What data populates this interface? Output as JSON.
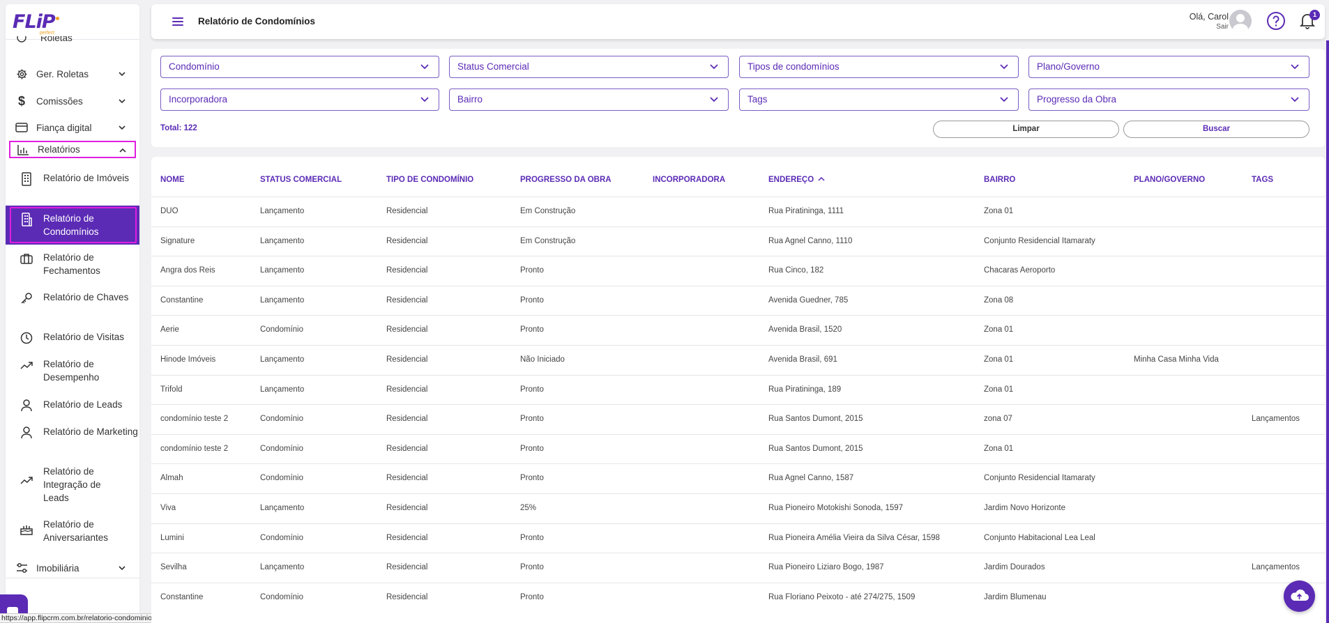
{
  "sidebar": {
    "logo": "FLiP",
    "logo_sub": "perfect",
    "items": [
      {
        "label": "Roletas",
        "icon": "roulette-icon"
      },
      {
        "label": "Ger. Roletas",
        "icon": "gear-icon"
      },
      {
        "label": "Comissões",
        "icon": "dollar-icon"
      },
      {
        "label": "Fiança digital",
        "icon": "credit-card-icon"
      },
      {
        "label": "Relatórios",
        "icon": "bar-chart-icon"
      },
      {
        "label": "Imobiliária",
        "icon": "settings-sliders-icon"
      }
    ],
    "reports": [
      {
        "label": "Relatório de Imóveis",
        "icon": "building-icon"
      },
      {
        "label": "Relatório de Condomínios",
        "icon": "condo-building-icon"
      },
      {
        "label": "Relatório de Fechamentos",
        "icon": "briefcase-icon"
      },
      {
        "label": "Relatório de Chaves",
        "icon": "key-icon"
      },
      {
        "label": "Relatório de Visitas",
        "icon": "clock-icon"
      },
      {
        "label": "Relatório de Desempenho",
        "icon": "trending-up-icon"
      },
      {
        "label": "Relatório de Leads",
        "icon": "user-icon"
      },
      {
        "label": "Relatório de Marketing",
        "icon": "user-icon"
      },
      {
        "label": "Relatório de Integração de Leads",
        "icon": "trending-up-icon"
      },
      {
        "label": "Relatório de Aniversariantes",
        "icon": "cake-icon"
      }
    ]
  },
  "status_url": "https://app.flipcrm.com.br/relatorio-condominios",
  "header": {
    "title": "Relatório de Condomínios",
    "greeting": "Olá, Carol",
    "logout": "Sair",
    "notification_count": "1"
  },
  "filters": {
    "row1": [
      "Condomínio",
      "Status Comercial",
      "Tipos de condomínios",
      "Plano/Governo"
    ],
    "row2": [
      "Incorporadora",
      "Bairro",
      "Tags",
      "Progresso da Obra"
    ],
    "total": "Total: 122",
    "clear_label": "Limpar",
    "search_label": "Buscar"
  },
  "table": {
    "columns": [
      "NOME",
      "STATUS COMERCIAL",
      "TIPO DE CONDOMÍNIO",
      "PROGRESSO DA OBRA",
      "INCORPORADORA",
      "ENDEREÇO",
      "BAIRRO",
      "PLANO/GOVERNO",
      "TAGS"
    ],
    "rows": [
      [
        "DUO",
        "Lançamento",
        "Residencial",
        "Em Construção",
        "",
        "Rua Piratininga, 1111",
        "Zona 01",
        "",
        ""
      ],
      [
        "Signature",
        "Lançamento",
        "Residencial",
        "Em Construção",
        "",
        "Rua Agnel Canno, 1110",
        "Conjunto Residencial Itamaraty",
        "",
        ""
      ],
      [
        "Angra dos Reis",
        "Lançamento",
        "Residencial",
        "Pronto",
        "",
        "Rua Cinco, 182",
        "Chacaras Aeroporto",
        "",
        ""
      ],
      [
        "Constantine",
        "Lançamento",
        "Residencial",
        "Pronto",
        "",
        "Avenida Guedner, 785",
        "Zona 08",
        "",
        ""
      ],
      [
        "Aerie",
        "Condomínio",
        "Residencial",
        "Pronto",
        "",
        "Avenida Brasil, 1520",
        "Zona 01",
        "",
        ""
      ],
      [
        "Hinode Imóveis",
        "Lançamento",
        "Residencial",
        "Não Iniciado",
        "",
        "Avenida Brasil, 691",
        "Zona 01",
        "Minha Casa Minha Vida",
        ""
      ],
      [
        "Trifold",
        "Lançamento",
        "Residencial",
        "Pronto",
        "",
        "Rua Piratininga, 189",
        "Zona 01",
        "",
        ""
      ],
      [
        "condomínio teste 2",
        "Condomínio",
        "Residencial",
        "Pronto",
        "",
        "Rua Santos Dumont, 2015",
        "zona 07",
        "",
        "Lançamentos"
      ],
      [
        "condomínio teste 2",
        "Condomínio",
        "Residencial",
        "Pronto",
        "",
        "Rua Santos Dumont, 2015",
        "Zona 01",
        "",
        ""
      ],
      [
        "Almah",
        "Condomínio",
        "Residencial",
        "Pronto",
        "",
        "Rua Agnel Canno, 1587",
        "Conjunto Residencial Itamaraty",
        "",
        ""
      ],
      [
        "Viva",
        "Lançamento",
        "Residencial",
        "25%",
        "",
        "Rua Pioneiro Motokishi Sonoda, 1597",
        "Jardim Novo Horizonte",
        "",
        ""
      ],
      [
        "Lumini",
        "Condomínio",
        "Residencial",
        "Pronto",
        "",
        "Rua Pioneira Amélia Vieira da Silva César, 1598",
        "Conjunto Habitacional Lea Leal",
        "",
        ""
      ],
      [
        "Sevilha",
        "Lançamento",
        "Residencial",
        "Pronto",
        "",
        "Rua Pioneiro Liziaro Bogo, 1987",
        "Jardim Dourados",
        "",
        "Lançamentos"
      ],
      [
        "Constantine",
        "Condomínio",
        "Residencial",
        "Pronto",
        "",
        "Rua Floriano Peixoto - até 274/275, 1509",
        "Jardim Blumenau",
        "",
        ""
      ]
    ]
  },
  "colors": {
    "brand": "#5b2bb5",
    "highlight": "#e01ee0"
  }
}
